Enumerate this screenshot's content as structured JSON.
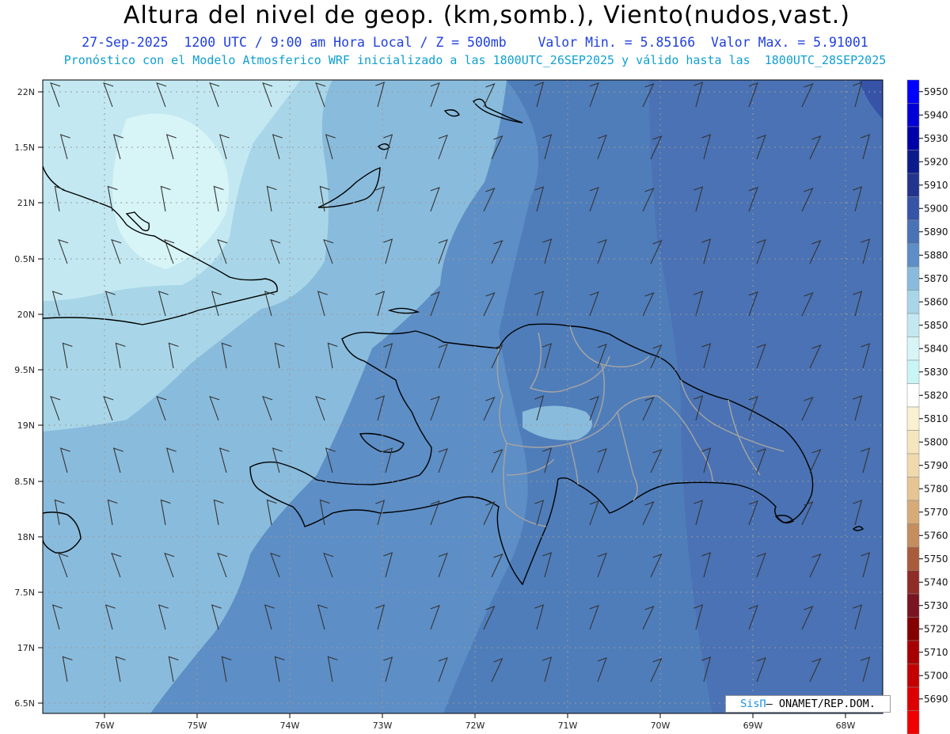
{
  "title": "Altura del nivel de geop. (km,somb.), Viento(nudos,vast.)",
  "subtitle_1": "27-Sep-2025  1200 UTC / 9:00 am Hora Local / Z = 500mb    Valor Min. = 5.85166  Valor Max. = 5.91001",
  "subtitle_2": "Pronóstico con el Modelo Atmosferico WRF inicializado a las 1800UTC_26SEP2025 y válido hasta las  1800UTC_28SEP2025",
  "credit": {
    "brand": "SisΠ",
    "org": "– ONAMET/REP.DOM."
  },
  "axes": {
    "lat_labels": [
      "22N",
      "1.5N",
      "21N",
      "0.5N",
      "20N",
      "9.5N",
      "19N",
      "8.5N",
      "18N",
      "7.5N",
      "17N",
      "6.5N"
    ],
    "lon_labels": [
      "76W",
      "75W",
      "74W",
      "73W",
      "72W",
      "71W",
      "70W",
      "69W",
      "68W"
    ]
  },
  "colorbar": {
    "levels": [
      "5950",
      "5940",
      "5930",
      "5920",
      "5910",
      "5900",
      "5890",
      "5880",
      "5870",
      "5860",
      "5850",
      "5840",
      "5830",
      "5820",
      "5810",
      "5800",
      "5790",
      "5780",
      "5770",
      "5760",
      "5750",
      "5740",
      "5730",
      "5720",
      "5710",
      "5700",
      "5690"
    ],
    "colors": [
      "#0000ff",
      "#0000d8",
      "#0000a8",
      "#0c1b8c",
      "#23348f",
      "#3653a8",
      "#4a72b4",
      "#5d8ec6",
      "#89bbdc",
      "#a8d6e8",
      "#c3e8f1",
      "#d7f4f6",
      "#c9f6f4",
      "#ffffff",
      "#faf1d0",
      "#f5e6bd",
      "#f0d9ac",
      "#e6c594",
      "#d7ab78",
      "#c48e5e",
      "#a95c3c",
      "#8f2c28",
      "#7a1420",
      "#840000",
      "#a80000",
      "#c40000",
      "#dc0000",
      "#f00000"
    ]
  },
  "colors": {
    "land_outline": "#000000",
    "province_lines": "#999999",
    "wind_barbs": "#333333"
  }
}
